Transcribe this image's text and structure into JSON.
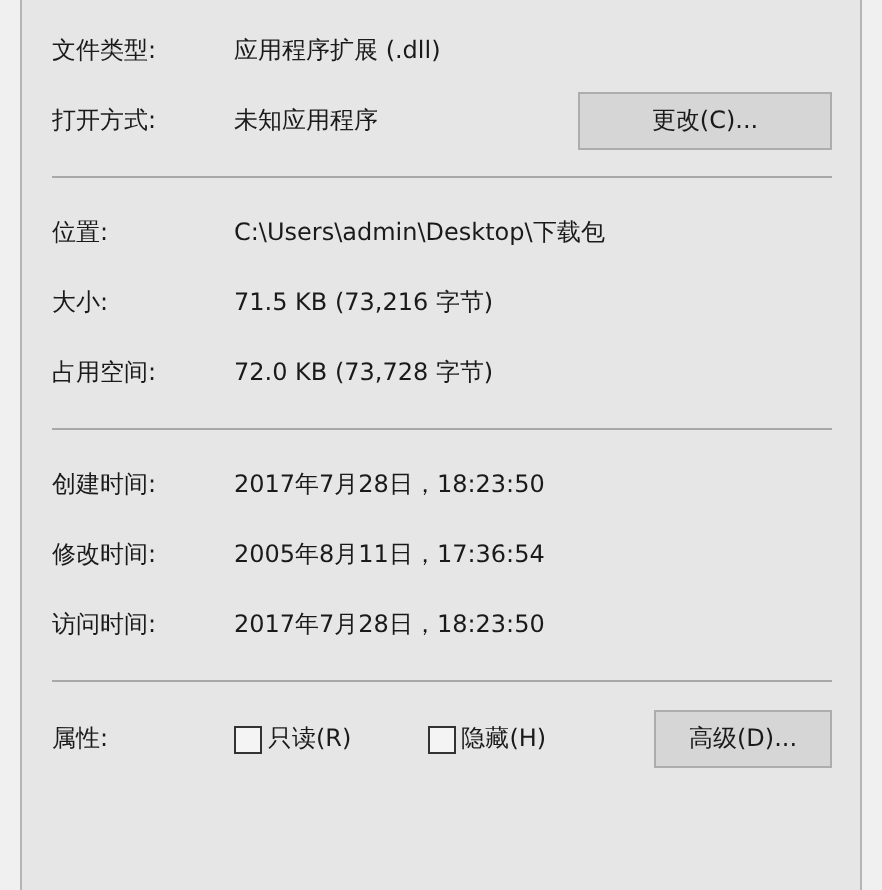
{
  "sections": [
    {
      "rows": [
        {
          "label": "文件类型:",
          "value": "应用程序扩展 (.dll)"
        },
        {
          "label": "打开方式:",
          "value": "未知应用程序",
          "button": "更改(C)..."
        }
      ]
    },
    {
      "rows": [
        {
          "label": "位置:",
          "value": "C:\\Users\\admin\\Desktop\\下载包"
        },
        {
          "label": "大小:",
          "value": "71.5 KB (73,216 字节)"
        },
        {
          "label": "占用空间:",
          "value": "72.0 KB (73,728 字节)"
        }
      ]
    },
    {
      "rows": [
        {
          "label": "创建时间:",
          "value": "2017年7月28日，18:23:50"
        },
        {
          "label": "修改时间:",
          "value": "2005年8月11日，17:36:54"
        },
        {
          "label": "访问时间:",
          "value": "2017年7月28日，18:23:50"
        }
      ]
    }
  ],
  "attributes": {
    "label": "属性:",
    "checkboxes": [
      {
        "label": "只读(R)",
        "checked": false
      },
      {
        "label": "隐藏(H)",
        "checked": false
      }
    ],
    "button": "高级(D)..."
  }
}
